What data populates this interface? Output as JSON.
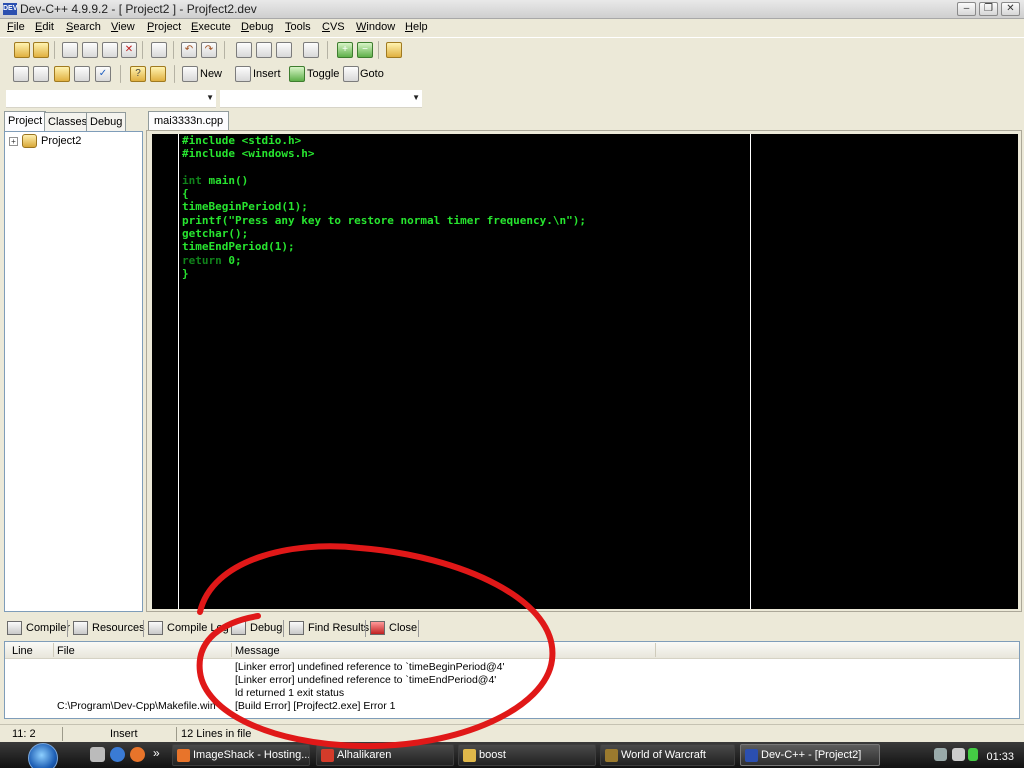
{
  "window": {
    "title": "Dev-C++ 4.9.9.2  - [ Project2 ] - Projfect2.dev",
    "app_icon_text": "DEV"
  },
  "menubar": {
    "items": [
      {
        "label": "File",
        "u": "F",
        "rest": "ile"
      },
      {
        "label": "Edit",
        "u": "E",
        "rest": "dit"
      },
      {
        "label": "Search",
        "u": "S",
        "rest": "earch"
      },
      {
        "label": "View",
        "u": "V",
        "rest": "iew"
      },
      {
        "label": "Project",
        "u": "P",
        "rest": "roject"
      },
      {
        "label": "Execute",
        "u": "E",
        "rest": "xecute"
      },
      {
        "label": "Debug",
        "u": "D",
        "rest": "ebug"
      },
      {
        "label": "Tools",
        "u": "T",
        "rest": "ools"
      },
      {
        "label": "CVS",
        "u": "C",
        "rest": "VS"
      },
      {
        "label": "Window",
        "u": "W",
        "rest": "indow"
      },
      {
        "label": "Help",
        "u": "H",
        "rest": "elp"
      }
    ]
  },
  "toolbar2": {
    "new_label": "New",
    "insert_label": "Insert",
    "toggle_label": "Toggle",
    "goto_label": "Goto"
  },
  "left_panel": {
    "tabs": [
      "Project",
      "Classes",
      "Debug"
    ],
    "tree_root": "Project2",
    "expander": "+"
  },
  "editor": {
    "tab_label": "mai3333n.cpp",
    "lines": [
      "#include <stdio.h>",
      "#include <windows.h>",
      "",
      "int main()",
      "{",
      "timeBeginPeriod(1);",
      "printf(\"Press any key to restore normal timer frequency.\\n\");",
      "getchar();",
      "timeEndPeriod(1);",
      "return 0;",
      "}"
    ]
  },
  "bottom_tabs": [
    "Compiler",
    "Resources",
    "Compile Log",
    "Debug",
    "Find Results",
    "Close"
  ],
  "messages": {
    "columns": [
      "Line",
      "File",
      "Message"
    ],
    "rows": [
      {
        "line": "",
        "file": "",
        "message": "[Linker error] undefined reference to `timeBeginPeriod@4'"
      },
      {
        "line": "",
        "file": "",
        "message": "[Linker error] undefined reference to `timeEndPeriod@4'"
      },
      {
        "line": "",
        "file": "",
        "message": "ld returned 1 exit status"
      },
      {
        "line": "",
        "file": "C:\\Program\\Dev-Cpp\\Makefile.win",
        "message": "[Build Error]  [Projfect2.exe] Error 1"
      }
    ]
  },
  "statusbar": {
    "position": "11: 2",
    "mode": "Insert",
    "lines_info": "12 Lines in file"
  },
  "taskbar": {
    "tasks": [
      {
        "label": "ImageShack - Hosting...",
        "icon_color": "#e8742a"
      },
      {
        "label": "Alhalikaren",
        "icon_color": "#d43b2a"
      },
      {
        "label": "boost",
        "icon_color": "#e0b84a"
      },
      {
        "label": "World of Warcraft",
        "icon_color": "#9b7a2e"
      },
      {
        "label": "Dev-C++ - [Project2]",
        "icon_color": "#2b4fb0"
      }
    ],
    "show_more": "»",
    "clock": "01:33"
  },
  "colors": {
    "code_green": "#27e52f",
    "keyword_green": "#10821a",
    "editor_bg": "#000000",
    "annotation_red": "#e01818"
  }
}
